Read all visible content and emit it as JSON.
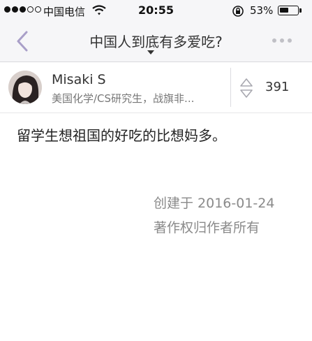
{
  "status_bar": {
    "carrier": "中国电信",
    "time": "20:55",
    "battery_percent": "53%",
    "battery_level": 0.53,
    "signal_bars_filled": 3,
    "signal_bars_total": 5
  },
  "nav": {
    "title": "中国人到底有多爱吃?",
    "back_icon": "chevron-left-icon",
    "more_icon": "more-dots-icon"
  },
  "author": {
    "name": "Misaki S",
    "bio": "美国化学/CS研究生，战旗非...",
    "vote_count": "391"
  },
  "answer": {
    "text": "留学生想祖国的好吃的比想妈多。",
    "created": "创建于 2016-01-24",
    "copyright": "著作权归作者所有"
  },
  "colors": {
    "bar_background": "#f6f6f8",
    "nav_icon": "#a99fc8",
    "meta_text": "#8a8a8a"
  }
}
